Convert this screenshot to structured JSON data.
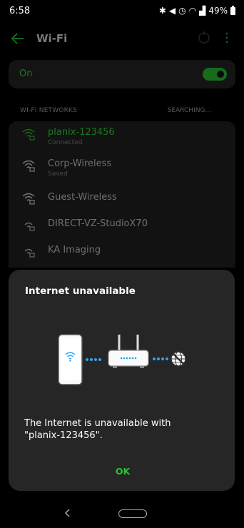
{
  "status_bar": {
    "time": "6:58",
    "battery_text": "49%",
    "icons": [
      "bluetooth-icon",
      "mute-icon",
      "alarm-icon",
      "wifi-icon",
      "signal-icon",
      "battery-icon"
    ]
  },
  "app_bar": {
    "title": "Wi-Fi",
    "back_icon": "back-arrow-icon",
    "refresh_icon": "refresh-icon",
    "more_icon": "more-vert-icon"
  },
  "toggle": {
    "label": "On",
    "state": true,
    "accent_color": "#1fa32a"
  },
  "networks_section": {
    "label": "WI-FI NETWORKS",
    "status": "SEARCHING..."
  },
  "networks": [
    {
      "name": "planix-123456",
      "status": "Connected"
    },
    {
      "name": "Corp-Wireless",
      "status": "Saved"
    },
    {
      "name": "Guest-Wireless",
      "status": ""
    },
    {
      "name": "DIRECT-VZ-StudioX70",
      "status": ""
    },
    {
      "name": "KA Imaging",
      "status": ""
    }
  ],
  "dialog": {
    "title": "Internet unavailable",
    "message": "The Internet is unavailable with\n\"planix-123456\".",
    "ok_label": "OK",
    "illustration_icons": [
      "phone-wifi-icon",
      "router-icon",
      "no-internet-globe-icon"
    ],
    "accent_color": "#2ec12e"
  },
  "nav_bar": {
    "icons": [
      "nav-back-icon",
      "nav-home-icon"
    ]
  }
}
